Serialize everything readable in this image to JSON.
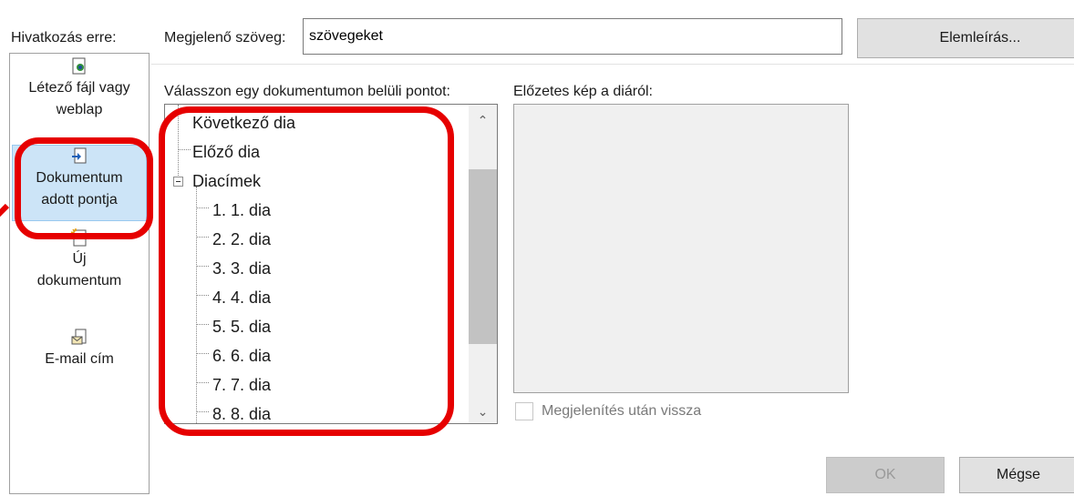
{
  "link_panel": {
    "label": "Hivatkozás erre:",
    "items": [
      {
        "line1": "Létező fájl vagy",
        "line2": "weblap",
        "icon": "existing-file-icon"
      },
      {
        "line1": "Dokumentum",
        "line2": "adott pontja",
        "icon": "place-in-document-icon",
        "selected": true
      },
      {
        "line1": "Új",
        "line2": "dokumentum",
        "icon": "new-document-icon"
      },
      {
        "line1": "E-mail cím",
        "line2": "",
        "icon": "email-icon"
      }
    ]
  },
  "display_text": {
    "label": "Megjelenő szöveg:",
    "value": "szövegeket"
  },
  "screentip_button": "Elemleírás...",
  "select_place": {
    "label": "Válasszon egy dokumentumon belüli pontot:",
    "items": [
      "Következő dia",
      "Előző dia",
      "Diacímek",
      "1. 1. dia",
      "2. 2. dia",
      "3. 3. dia",
      "4. 4. dia",
      "5. 5. dia",
      "6. 6. dia",
      "7. 7. dia",
      "8. 8. dia"
    ]
  },
  "preview": {
    "label": "Előzetes kép a diáról:",
    "show_and_return_label": "Megjelenítés után vissza",
    "show_and_return_checked": false
  },
  "buttons": {
    "ok": "OK",
    "cancel": "Mégse"
  },
  "colors": {
    "annotation": "#e60000",
    "selection": "#cce4f7"
  }
}
